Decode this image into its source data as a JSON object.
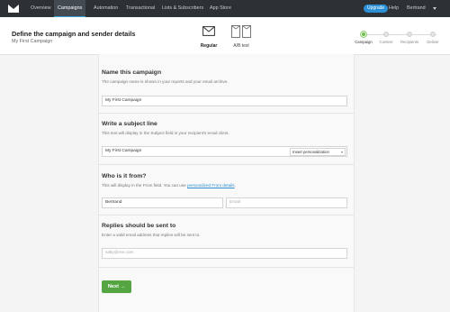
{
  "topnav": {
    "items": [
      "Overview",
      "Campaigns",
      "Automation",
      "Transactional",
      "Lists & Subscribers",
      "App Store"
    ],
    "active": "Campaigns",
    "upgrade_label": "Upgrade",
    "help_label": "Help",
    "user_label": "Bertrand"
  },
  "header": {
    "title": "Define the campaign and sender details",
    "subtitle": "My First Campaign",
    "types": {
      "regular": "Regular",
      "ab": "A/B test"
    },
    "steps": [
      "Campaign",
      "Content",
      "Recipients",
      "Deliver"
    ]
  },
  "form": {
    "name": {
      "title": "Name this campaign",
      "desc": "The campaign name is shown in your reports and your email archive.",
      "value": "My First Campaign"
    },
    "subject": {
      "title": "Write a subject line",
      "desc": "This text will display in the Subject field in your recipient's email client.",
      "value": "My First Campaign",
      "personalization": "Insert personalization"
    },
    "from": {
      "title": "Who is it from?",
      "desc": "This will display in the From field. You can use",
      "link": "personalized From details",
      "desc_end": ".",
      "name_value": "Bertrand",
      "email_placeholder": "Email"
    },
    "replies": {
      "title": "Replies should be sent to",
      "desc": "Enter a valid email address that replies will be sent to.",
      "placeholder": "sally@me.com"
    },
    "next_label": "Next →"
  }
}
